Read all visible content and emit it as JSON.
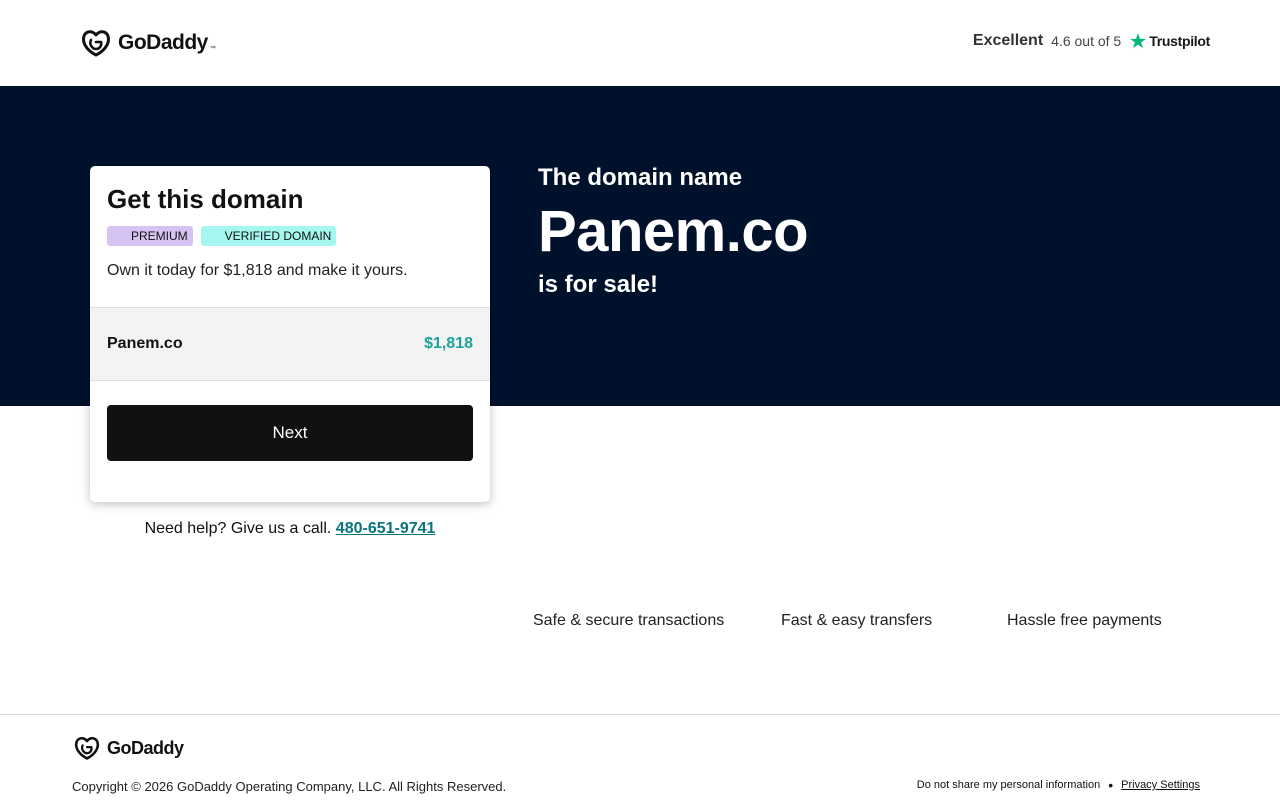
{
  "header": {
    "logo_text": "GoDaddy",
    "rating_label": "Excellent",
    "rating_score": "4.6 out of 5",
    "rating_brand": "Trustpilot"
  },
  "hero": {
    "pre": "The domain name",
    "domain": "Panem.co",
    "post": "is for sale!"
  },
  "card": {
    "title": "Get this domain",
    "badges": [
      "PREMIUM",
      "VERIFIED DOMAIN"
    ],
    "description": "Own it today for $1,818 and make it yours.",
    "row_domain": "Panem.co",
    "row_price": "$1,818",
    "next_label": "Next"
  },
  "help": {
    "text": "Need help? Give us a call.",
    "phone": "480-651-9741"
  },
  "features": [
    "Safe & secure transactions",
    "Fast & easy transfers",
    "Hassle free payments"
  ],
  "footer": {
    "logo_text": "GoDaddy",
    "copyright": "Copyright © 2026 GoDaddy Operating Company, LLC. All Rights Reserved.",
    "do_not_share": "Do not share my personal information",
    "privacy": "Privacy Settings"
  },
  "colors": {
    "hero_bg": "#00112c",
    "price": "#1ba39c",
    "link": "#09757a",
    "trustpilot_star": "#00b67a",
    "premium_badge": "#d5c4f3",
    "verified_badge": "#a3f7ef"
  },
  "icons": [
    "godaddy-logo-icon",
    "trustpilot-star-icon"
  ]
}
